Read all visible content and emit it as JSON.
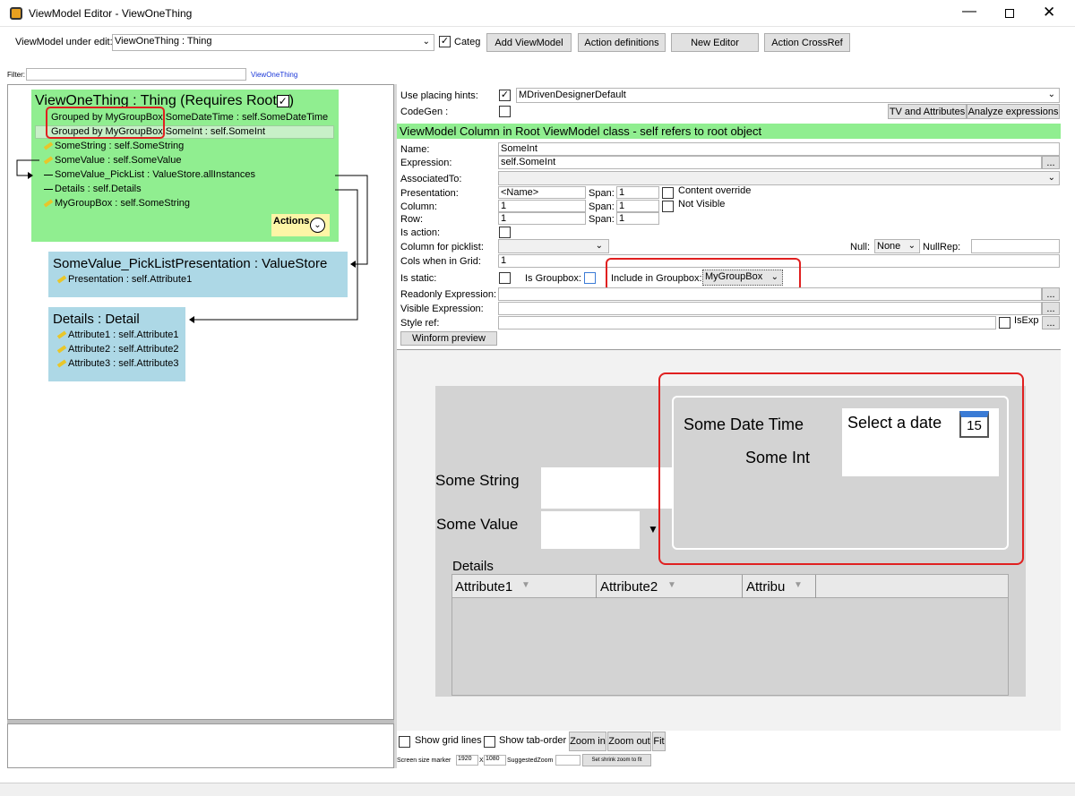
{
  "window": {
    "title": "ViewModel Editor - ViewOneThing"
  },
  "toolbar": {
    "vm_label": "ViewModel under edit:",
    "vm_value": "ViewOneThing : Thing",
    "categ_label": "Categ",
    "add_vm": "Add ViewModel",
    "action_defs": "Action definitions",
    "new_editor": "New Editor",
    "action_crossref": "Action CrossRef"
  },
  "filter": {
    "label": "Filter:",
    "value": "",
    "link": "ViewOneThing"
  },
  "tree": {
    "root_title": "ViewOneThing : Thing  (Requires Root",
    "root_close": ")",
    "rows": [
      {
        "prefix": "Grouped by MyGroupBox",
        "text": " SomeDateTime : self.SomeDateTime"
      },
      {
        "prefix": "Grouped by MyGroupBox",
        "text": " SomeInt : self.SomeInt"
      },
      {
        "text": "SomeString : self.SomeString"
      },
      {
        "text": "SomeValue : self.SomeValue"
      },
      {
        "text": "SomeValue_PickList : ValueStore.allInstances"
      },
      {
        "text": "Details : self.Details"
      },
      {
        "text": "MyGroupBox : self.SomeString"
      }
    ],
    "actions_label": "Actions",
    "picklist_title": "SomeValue_PickListPresentation : ValueStore",
    "picklist_rows": [
      "Presentation : self.Attribute1"
    ],
    "details_title": "Details : Detail",
    "details_rows": [
      "Attribute1 : self.Attribute1",
      "Attribute2 : self.Attribute2",
      "Attribute3 : self.Attribute3"
    ]
  },
  "props": {
    "use_placing_hints": "Use placing hints:",
    "placing_value": "MDrivenDesignerDefault",
    "codegen": "CodeGen :",
    "tv_attrs": "TV and Attributes",
    "analyze": "Analyze expressions",
    "header": "ViewModel Column in Root ViewModel class - self refers to root object",
    "name_label": "Name:",
    "name_value": "SomeInt",
    "expression_label": "Expression:",
    "expression_value": "self.SomeInt",
    "associated_label": "AssociatedTo:",
    "presentation_label": "Presentation:",
    "presentation_value": "<Name>",
    "column_label": "Column:",
    "column_value": "1",
    "row_label": "Row:",
    "row_value": "1",
    "span_label": "Span:",
    "span1": "1",
    "span2": "1",
    "span3": "1",
    "content_override": "Content override",
    "not_visible": "Not Visible",
    "is_action": "Is action:",
    "picklist_col": "Column for picklist:",
    "null_label": "Null:",
    "null_value": "None",
    "nullrep_label": "NullRep:",
    "cols_grid": "Cols when in Grid:",
    "cols_grid_value": "1",
    "is_static": "Is static:",
    "is_groupbox": "Is Groupbox:",
    "include_groupbox": "Include in Groupbox:",
    "groupbox_value": "MyGroupBox",
    "readonly_expr": "Readonly Expression:",
    "visible_expr": "Visible Expression:",
    "style_ref": "Style ref:",
    "isexp": "IsExp",
    "winform_preview": "Winform preview",
    "ellipsis": "..."
  },
  "preview": {
    "some_date_time": "Some Date Time",
    "select_date": "Select a date",
    "calendar_day": "15",
    "some_int": "Some Int",
    "some_string": "Some String",
    "some_value": "Some Value",
    "details": "Details",
    "columns": [
      "Attribute1",
      "Attribute2",
      "Attribu"
    ]
  },
  "bottom": {
    "show_grid": "Show grid lines",
    "show_tab": "Show tab-order",
    "zoom_in": "Zoom in",
    "zoom_out": "Zoom out",
    "fit": "Fit",
    "screen_marker": "Screen size marker",
    "w": "1920",
    "x": "X",
    "h": "1080",
    "suggested": "SuggestedZoom",
    "set_shrink": "Set shrink zoom to fit"
  },
  "colors": {
    "green": "#90ee90",
    "blue": "#add8e6",
    "red": "#e02020",
    "preview_bg": "#d3d3d3"
  }
}
